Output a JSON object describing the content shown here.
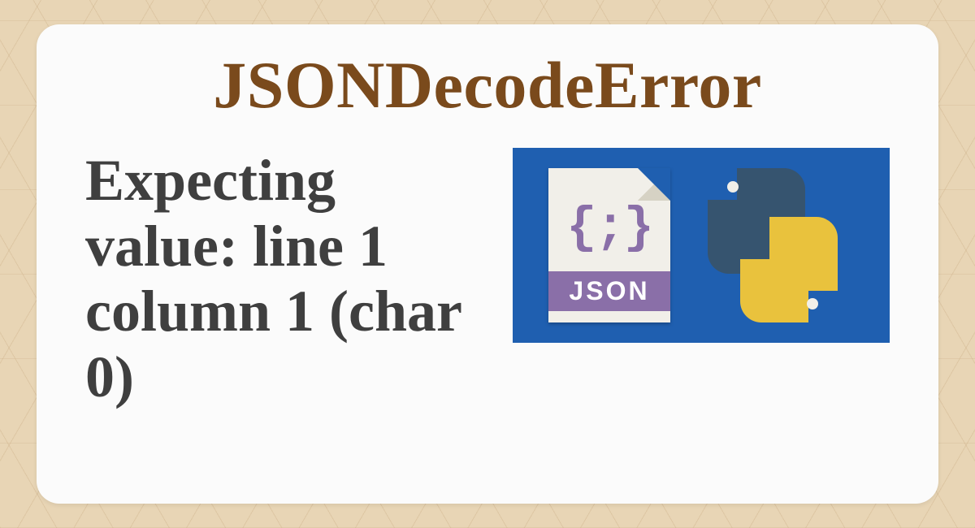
{
  "title": "JSONDecodeError",
  "message": "Expecting value: line 1 column 1 (char 0)",
  "file_icon": {
    "braces": "{;}",
    "band": "JSON"
  },
  "colors": {
    "title": "#7a4a1c",
    "text": "#3f3f3f",
    "panel": "#1f5fb0",
    "json_purple": "#8a6fa8",
    "py_blue": "#36546f",
    "py_yellow": "#e9c23d",
    "page_bg": "#e8d5b5"
  }
}
